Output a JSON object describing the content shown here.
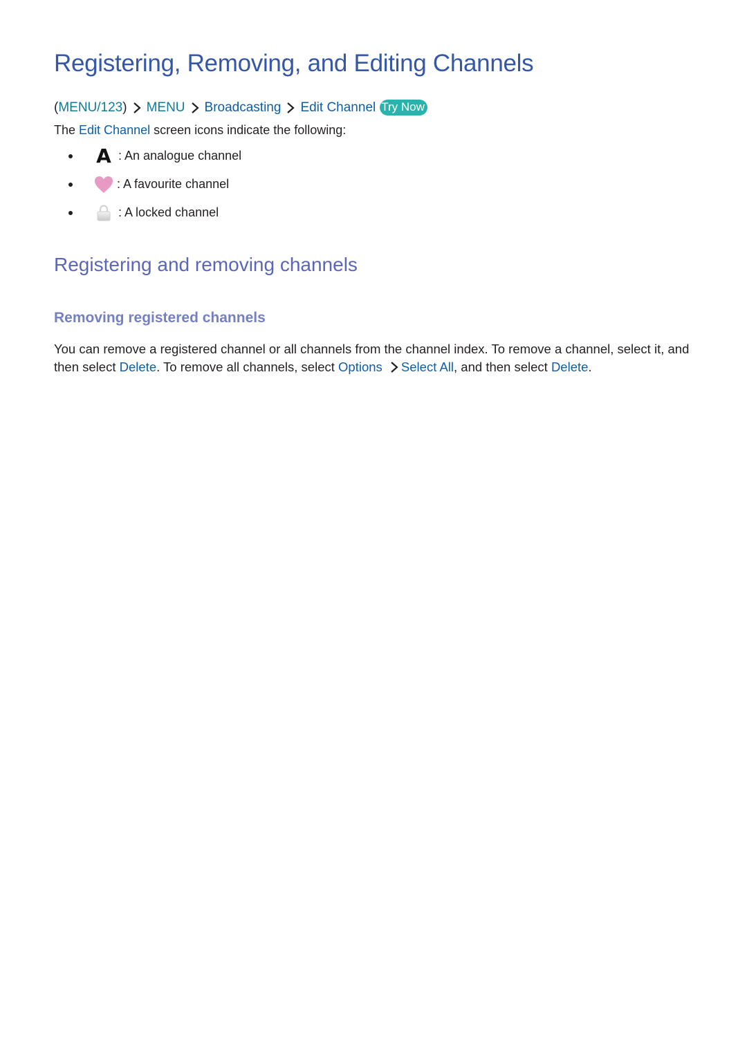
{
  "title": "Registering, Removing, and Editing Channels",
  "breadcrumb": {
    "items": [
      "MENU/123",
      "MENU",
      "Broadcasting",
      "Edit Channel"
    ],
    "try_now": "Try Now"
  },
  "intro": {
    "prefix": "The ",
    "link": "Edit Channel",
    "suffix": " screen icons indicate the following:"
  },
  "icon_legend": [
    {
      "icon": "analogue-icon",
      "glyph": "A",
      "text": ": An analogue channel"
    },
    {
      "icon": "heart-icon",
      "text": ": A favourite channel"
    },
    {
      "icon": "lock-icon",
      "text": ": A locked channel"
    }
  ],
  "section_heading": "Registering and removing channels",
  "subsection_heading": "Removing registered channels",
  "body": {
    "t1": "You can remove a registered channel or all channels from the channel index. To remove a channel, select it, and then select ",
    "l1": "Delete",
    "t2": ". To remove all channels, select ",
    "l2": "Options",
    "l3": "Select All",
    "t3": ", and then select ",
    "l4": "Delete",
    "t4": "."
  },
  "colors": {
    "title": "#3557a5",
    "section": "#5a67b8",
    "subsection": "#7480c2",
    "link": "#0d5ea8",
    "try_now_bg": "#2ab3ac",
    "heart": "#e79ac3"
  }
}
